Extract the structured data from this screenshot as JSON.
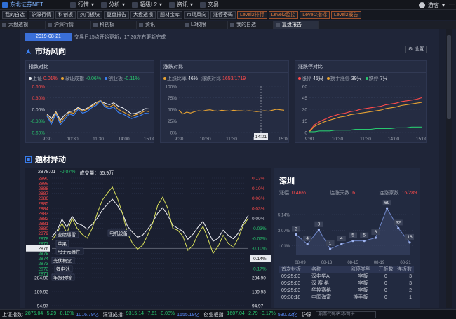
{
  "app": {
    "title": "东北证券NET"
  },
  "top_menu": [
    {
      "label": "行情",
      "arrow": "▾"
    },
    {
      "label": "分析",
      "arrow": "▾"
    },
    {
      "label": "超级L2",
      "arrow": "▾"
    },
    {
      "label": "资讯",
      "arrow": "▾"
    },
    {
      "label": "交易",
      "arrow": ""
    }
  ],
  "user": {
    "name": "游客",
    "arrow": "▾"
  },
  "quickbar": [
    {
      "label": "我的自选",
      "level2": false
    },
    {
      "label": "沪深行情",
      "level2": false
    },
    {
      "label": "科创板",
      "level2": false
    },
    {
      "label": "热门板块",
      "level2": false
    },
    {
      "label": "复盘报告",
      "level2": false
    },
    {
      "label": "大盘透视",
      "level2": false
    },
    {
      "label": "题材宝库",
      "level2": false
    },
    {
      "label": "市场风向",
      "level2": false
    },
    {
      "label": "涨停密码",
      "level2": false
    },
    {
      "label": "Level2排行",
      "level2": true
    },
    {
      "label": "Level2监控",
      "level2": true
    },
    {
      "label": "Level2指标",
      "level2": true
    },
    {
      "label": "Level2报告",
      "level2": true
    }
  ],
  "tabs": [
    {
      "label": "大盘透视",
      "active": false
    },
    {
      "label": "沪深行情",
      "active": false
    },
    {
      "label": "科创板",
      "active": false
    },
    {
      "label": "资讯",
      "active": false
    },
    {
      "label": "L2权限",
      "active": false
    },
    {
      "label": "我的自选",
      "active": false
    },
    {
      "label": "复盘报告",
      "active": true
    }
  ],
  "report": {
    "date": "2019-08-21",
    "note": "交易日15点开始更新，17:30左右更新完成"
  },
  "market": {
    "title": "市场风向",
    "settings_label": "设置",
    "index_panel": {
      "title": "指数对比",
      "legend": [
        {
          "name": "上证",
          "value": "0.01%",
          "color": "#e6e9ef",
          "value_color": "#ff4b4b"
        },
        {
          "name": "深证成指",
          "value": "-0.06%",
          "color": "#e6a233",
          "value_color": "#28c76f"
        },
        {
          "name": "创业板",
          "value": "-0.11%",
          "color": "#3b82f6",
          "value_color": "#28c76f"
        }
      ]
    },
    "rise_panel": {
      "title": "涨跌对比",
      "legend": [
        {
          "name": "上涨比率",
          "value": "46%",
          "color": "#e6a233",
          "value_color": "#e8eaef"
        },
        {
          "name": "涨跌对比",
          "value": "1653/1719",
          "color": "",
          "value_color": "#ff4b4b"
        }
      ],
      "cursor_label": "14:01"
    },
    "limit_panel": {
      "title": "涨跌停对比",
      "legend": [
        {
          "name": "涨停",
          "value": "45只",
          "color": "#ff4b4b",
          "value_color": "#e8eaef"
        },
        {
          "name": "换手涨停",
          "value": "39只",
          "color": "#e6a233",
          "value_color": "#e8eaef"
        },
        {
          "name": "跌停",
          "value": "7只",
          "color": "#28c76f",
          "value_color": "#e8eaef"
        }
      ]
    }
  },
  "theme": {
    "title": "题材异动",
    "quote_line": {
      "price": "2878.01",
      "change": "-0.07%",
      "volume_label": "成交量：",
      "volume": "55.9万"
    },
    "annotations": [
      "业绩爆雷",
      "苹果",
      "电子元器件",
      "光伏概念",
      "锂电池",
      "年报预增",
      "电机设备"
    ]
  },
  "region": {
    "name": "深圳",
    "stats": [
      {
        "label": "涨幅",
        "value": "0.46%",
        "color": "#ff4b4b"
      },
      {
        "label": "连涨天数",
        "value": "6",
        "color": "#ff4b4b"
      },
      {
        "label": "连涨家数",
        "value": "16/289",
        "color": "#ff4b4b"
      }
    ],
    "table_headers": [
      "首次封板",
      "名称",
      "涨停类型",
      "开板数",
      "连板数"
    ],
    "table_rows": [
      [
        "09:25:03",
        "深中华A",
        "一字板",
        "0",
        "3"
      ],
      [
        "09:25:03",
        "深 赛 格",
        "一字板",
        "0",
        "3"
      ],
      [
        "09:25:03",
        "华控赛格",
        "一字板",
        "0",
        "2"
      ],
      [
        "09:30:18",
        "中国海富",
        "换手板",
        "0",
        "1"
      ]
    ]
  },
  "status_bar": [
    {
      "name": "上证指数:",
      "price": "2875.04",
      "chg": "-5.29",
      "pct": "-0.18%",
      "amt": "1016.79亿"
    },
    {
      "name": "深证成指:",
      "price": "9315.14",
      "chg": "-7.61",
      "pct": "-0.08%",
      "amt": "1655.19亿"
    },
    {
      "name": "创业板指:",
      "price": "1607.04",
      "chg": "-2.79",
      "pct": "-0.17%",
      "amt": "530.22亿"
    }
  ],
  "search": {
    "market": "沪深",
    "placeholder": "股票代码/名称/简拼"
  },
  "chart_data": [
    {
      "type": "line",
      "title": "指数对比",
      "x_ticks": [
        "9:30",
        "10:30",
        "11:30",
        "14:00",
        "15:00"
      ],
      "y_ticks": [
        "0.60%",
        "0.30%",
        "0.00%",
        "-0.30%",
        "-0.60%"
      ],
      "ylim": [
        -0.6,
        0.6
      ],
      "series": [
        {
          "name": "上证",
          "color": "#e6e9ef",
          "values": [
            -0.12,
            -0.24,
            -0.06,
            -0.28,
            -0.14,
            -0.06,
            -0.04,
            0.05,
            -0.02,
            0.03,
            0.1,
            0.18,
            0.22,
            0.16,
            0.12,
            0.17,
            0.08,
            0.04,
            -0.04,
            -0.12,
            -0.1,
            -0.06,
            0.02,
            0.01
          ]
        },
        {
          "name": "深证成指",
          "color": "#e6a233",
          "values": [
            -0.15,
            -0.32,
            -0.08,
            -0.34,
            -0.2,
            -0.08,
            -0.1,
            0.03,
            -0.05,
            0.0,
            0.08,
            0.14,
            0.24,
            0.1,
            0.06,
            0.12,
            0.0,
            -0.06,
            -0.12,
            -0.18,
            -0.14,
            -0.1,
            -0.04,
            -0.06
          ]
        },
        {
          "name": "创业板",
          "color": "#3b82f6",
          "values": [
            -0.18,
            -0.38,
            -0.12,
            -0.4,
            -0.26,
            -0.12,
            -0.16,
            0.0,
            -0.1,
            -0.06,
            0.04,
            0.1,
            0.22,
            0.06,
            0.02,
            0.06,
            -0.08,
            -0.12,
            -0.18,
            -0.24,
            -0.2,
            -0.16,
            -0.1,
            -0.11
          ]
        }
      ]
    },
    {
      "type": "line",
      "title": "涨跌对比",
      "x_ticks": [
        "9:30",
        "10:30",
        "11:30",
        "14:00",
        "15:00"
      ],
      "y_ticks": [
        "100%",
        "75%",
        "50%",
        "25%",
        "0%"
      ],
      "ylim": [
        0,
        100
      ],
      "series": [
        {
          "name": "上涨比率",
          "color": "#e6a233",
          "values": [
            48,
            40,
            44,
            42,
            45,
            47,
            46,
            48,
            49,
            47,
            46,
            48,
            47,
            46,
            48,
            47,
            47,
            46,
            47,
            46,
            45,
            46,
            47,
            46,
            48,
            50,
            49,
            48
          ]
        }
      ]
    },
    {
      "type": "line",
      "title": "涨跌停对比",
      "x_ticks": [
        "9:30",
        "10:30",
        "11:30",
        "14:00",
        "15:00"
      ],
      "y_ticks": [
        "60",
        "45",
        "30",
        "15",
        "0"
      ],
      "ylim": [
        0,
        60
      ],
      "series": [
        {
          "name": "涨停",
          "color": "#ff4b4b",
          "values": [
            2,
            10,
            14,
            17,
            20,
            22,
            24,
            25,
            27,
            28,
            30,
            31,
            32,
            33,
            34,
            36,
            37,
            38,
            40,
            41,
            42,
            43,
            45
          ]
        },
        {
          "name": "换手涨停",
          "color": "#e6a233",
          "values": [
            1,
            8,
            11,
            14,
            16,
            18,
            20,
            21,
            23,
            24,
            25,
            26,
            27,
            28,
            29,
            31,
            32,
            33,
            35,
            36,
            37,
            38,
            39
          ]
        },
        {
          "name": "跌停",
          "color": "#28c76f",
          "values": [
            1,
            1,
            2,
            2,
            2,
            3,
            3,
            3,
            3,
            4,
            4,
            4,
            4,
            5,
            5,
            5,
            5,
            6,
            6,
            6,
            7,
            7,
            7
          ]
        }
      ]
    },
    {
      "type": "line",
      "title": "",
      "left_ticks": [
        "2890",
        "2889",
        "2888",
        "2887",
        "2886",
        "2885",
        "2884",
        "2883",
        "2882",
        "2881",
        "2880",
        "2879",
        "2878",
        "2877",
        "2876",
        "2875",
        "2874",
        "2873",
        "2872",
        "2871"
      ],
      "right_ticks": [
        "0.13%",
        "0.10%",
        "0.06%",
        "0.03%",
        "0.00%",
        "-0.03%",
        "-0.07%",
        "-0.10%",
        "-0.14%",
        "-0.17%"
      ],
      "right_ticks_pos": [
        0,
        2,
        4,
        6,
        8,
        10,
        12,
        14,
        16,
        18
      ],
      "highlight_left": "2876",
      "highlight_right": "-0.14%",
      "volume_ticks": [
        "284.90",
        "189.93",
        "94.97"
      ],
      "ylim": [
        2871,
        2890
      ],
      "series": [
        {
          "name": "价格",
          "color": "#f2f3f7",
          "values": [
            2878.3,
            2879.5,
            2881.8,
            2880.2,
            2882.4,
            2881.0,
            2880.6,
            2879.8,
            2880.8,
            2882.0,
            2883.6,
            2884.8,
            2885.8,
            2884.6,
            2883.0,
            2880.4,
            2879.2,
            2878.2,
            2878.6,
            2879.8,
            2881.2,
            2883.0,
            2884.1,
            2882.6,
            2880.6,
            2880.0,
            2879.4,
            2877.8,
            2878.8,
            2880.2,
            2881.4,
            2879.4,
            2877.4,
            2878.0,
            2879.6,
            2878.6,
            2877.9,
            2879.0,
            2881.0,
            2882.6
          ]
        },
        {
          "name": "均价",
          "color": "#d9e05a",
          "values": [
            2877.6,
            2879.0,
            2881.0,
            2879.0,
            2882.0,
            2880.0,
            2878.8,
            2878.0,
            2880.0,
            2883.0,
            2885.6,
            2887.0,
            2888.2,
            2886.0,
            2883.0,
            2879.0,
            2877.0,
            2875.8,
            2876.6,
            2878.6,
            2881.0,
            2884.6,
            2886.2,
            2884.0,
            2880.0,
            2879.6,
            2878.4,
            2875.6,
            2876.6,
            2878.8,
            2880.4,
            2877.8,
            2875.0,
            2876.4,
            2878.6,
            2877.0,
            2876.2,
            2878.0,
            2880.6,
            2882.0
          ]
        }
      ]
    },
    {
      "type": "line",
      "title": "",
      "categories": [
        "08-09",
        "08-13",
        "08-15",
        "08-19",
        "08-21"
      ],
      "y_ticks": [
        "5.14%",
        "3.07%",
        "1.01%"
      ],
      "ylim": [
        0,
        6
      ],
      "labels": [
        "3",
        "4",
        "8",
        "1",
        "4",
        "5",
        "5",
        "6",
        "69",
        "32",
        "16"
      ],
      "values": [
        2.6,
        1.4,
        3.2,
        0.8,
        1.4,
        1.8,
        1.8,
        2.2,
        5.9,
        3.4,
        1.6
      ]
    }
  ]
}
